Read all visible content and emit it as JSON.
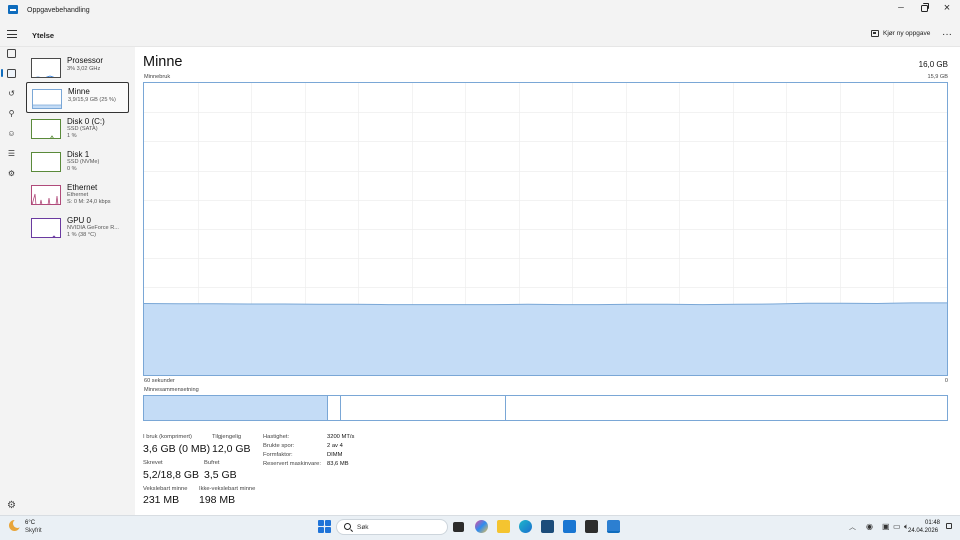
{
  "window": {
    "title": "Oppgavebehandling"
  },
  "header": {
    "section": "Ytelse",
    "run_task": "Kjør ny oppgave",
    "more": "···"
  },
  "sidebar": {
    "items": [
      {
        "name": "Prosessor",
        "sub1": "3%  3,02 GHz",
        "sub2": ""
      },
      {
        "name": "Minne",
        "sub1": "3,9/15,9 GB (25 %)",
        "sub2": ""
      },
      {
        "name": "Disk 0 (C:)",
        "sub1": "SSD (SATA)",
        "sub2": "1 %"
      },
      {
        "name": "Disk 1",
        "sub1": "SSD (NVMe)",
        "sub2": "0 %"
      },
      {
        "name": "Ethernet",
        "sub1": "Ethernet",
        "sub2": "S: 0  M: 24,0 kbps"
      },
      {
        "name": "GPU 0",
        "sub1": "NVIDIA GeForce R...",
        "sub2": "1 % (38 °C)"
      }
    ]
  },
  "main": {
    "title": "Minne",
    "total": "16,0 GB",
    "usage_label": "Minnebruk",
    "usage_max": "15,9 GB",
    "time_label": "60 sekunder",
    "time_end": "0",
    "composition_label": "Minnesammensetning",
    "stats": {
      "in_use_label": "I bruk (komprimert)",
      "in_use_value": "3,6 GB (0 MB)",
      "available_label": "Tilgjengelig",
      "available_value": "12,0 GB",
      "committed_label": "Skrevet",
      "committed_value": "5,2/18,8 GB",
      "cached_label": "Bufret",
      "cached_value": "3,5 GB",
      "paged_label": "Vekslebart minne",
      "paged_value": "231 MB",
      "nonpaged_label": "Ikke-vekslebart minne",
      "nonpaged_value": "198 MB"
    },
    "details": [
      {
        "key": "Hastighet:",
        "value": "3200 MT/s"
      },
      {
        "key": "Brukte spor:",
        "value": "2 av 4"
      },
      {
        "key": "Formfaktor:",
        "value": "DIMM"
      },
      {
        "key": "Reservert maskinvare:",
        "value": "83,6 MB"
      }
    ],
    "usage_series_fraction": [
      0.245,
      0.244,
      0.244,
      0.243,
      0.243,
      0.242,
      0.242,
      0.241,
      0.241,
      0.241,
      0.241,
      0.242,
      0.241,
      0.241,
      0.242,
      0.242,
      0.241,
      0.242,
      0.243,
      0.246,
      0.246,
      0.245,
      0.247,
      0.247
    ]
  },
  "taskbar": {
    "weather_temp": "6°C",
    "weather_desc": "Skyfrit",
    "search_placeholder": "Søk",
    "time": "01:48",
    "date": "24.04.2026"
  },
  "colors": {
    "accent": "#0f6cbd",
    "memory_fill": "#c4dcf6",
    "memory_line": "#7aa7d6"
  }
}
